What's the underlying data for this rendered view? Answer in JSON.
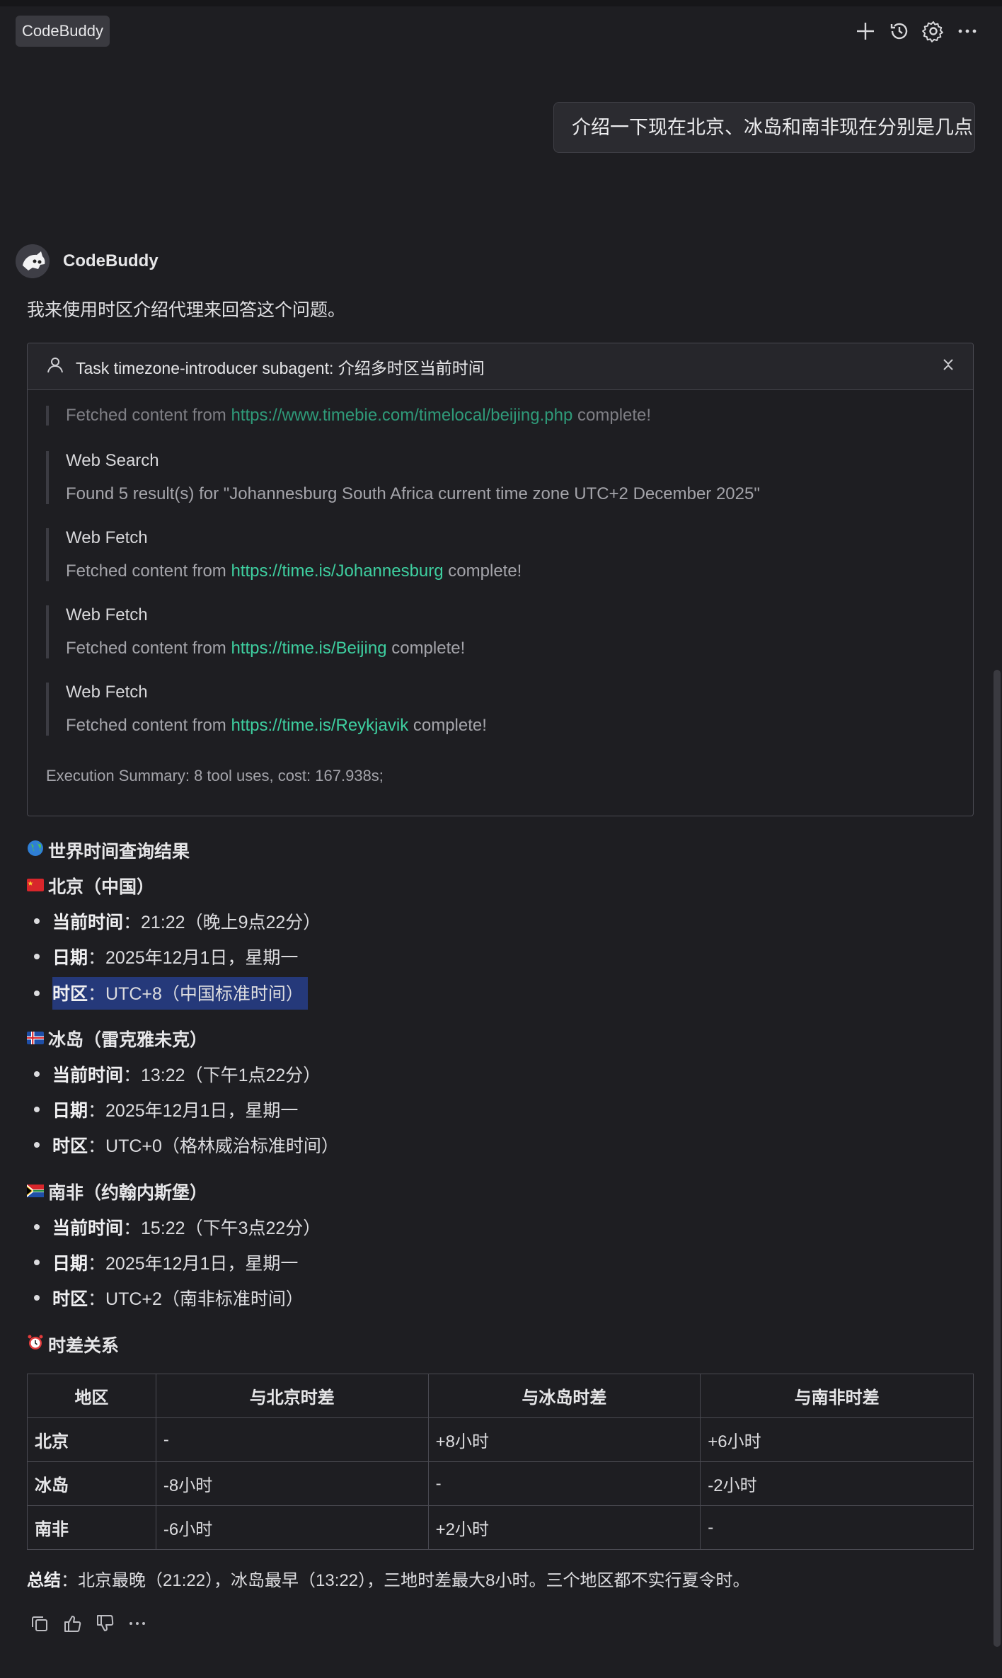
{
  "app": {
    "title": "CodeBuddy"
  },
  "toolbar": {
    "icons": [
      "plus-icon",
      "history-icon",
      "gear-icon",
      "more-icon"
    ]
  },
  "user_message": "介绍一下现在北京、冰岛和南非现在分别是几点",
  "assistant": {
    "name": "CodeBuddy",
    "intro": "我来使用时区介绍代理来回答这个问题。",
    "task": {
      "title": "Task timezone-introducer subagent: 介绍多时区当前时间",
      "steps": [
        {
          "name": "",
          "prefix": "Fetched content from ",
          "url": "https://www.timebie.com/timelocal/beijing.php",
          "suffix": " complete!"
        },
        {
          "name": "Web Search",
          "text": "Found 5 result(s) for \"Johannesburg South Africa current time zone UTC+2 December 2025\""
        },
        {
          "name": "Web Fetch",
          "prefix": "Fetched content from ",
          "url": "https://time.is/Johannesburg",
          "suffix": " complete!"
        },
        {
          "name": "Web Fetch",
          "prefix": "Fetched content from ",
          "url": "https://time.is/Beijing",
          "suffix": " complete!"
        },
        {
          "name": "Web Fetch",
          "prefix": "Fetched content from ",
          "url": "https://time.is/Reykjavik",
          "suffix": " complete!"
        }
      ],
      "summary": "Execution Summary: 8 tool uses, cost: 167.938s;"
    },
    "heading": "世界时间查询结果",
    "cities": [
      {
        "title": "北京（中国）",
        "flag": "china-flag",
        "items": [
          {
            "label": "当前时间",
            "value": "：21:22（晚上9点22分）"
          },
          {
            "label": "日期",
            "value": "：2025年12月1日，星期一"
          },
          {
            "label": "时区",
            "value": "：UTC+8（中国标准时间）"
          }
        ]
      },
      {
        "title": "冰岛（雷克雅未克）",
        "flag": "iceland-flag",
        "items": [
          {
            "label": "当前时间",
            "value": "：13:22（下午1点22分）"
          },
          {
            "label": "日期",
            "value": "：2025年12月1日，星期一"
          },
          {
            "label": "时区",
            "value": "：UTC+0（格林威治标准时间）"
          }
        ]
      },
      {
        "title": "南非（约翰内斯堡）",
        "flag": "south-africa-flag",
        "items": [
          {
            "label": "当前时间",
            "value": "：15:22（下午3点22分）"
          },
          {
            "label": "日期",
            "value": "：2025年12月1日，星期一"
          },
          {
            "label": "时区",
            "value": "：UTC+2（南非标准时间）"
          }
        ]
      }
    ],
    "diff_heading": "时差关系",
    "table": {
      "headers": [
        "地区",
        "与北京时差",
        "与冰岛时差",
        "与南非时差"
      ],
      "rows": [
        [
          "北京",
          "-",
          "+8小时",
          "+6小时"
        ],
        [
          "冰岛",
          "-8小时",
          "-",
          "-2小时"
        ],
        [
          "南非",
          "-6小时",
          "+2小时",
          "-"
        ]
      ]
    },
    "conclusion": {
      "label": "总结",
      "text": "：北京最晚（21:22），冰岛最早（13:22），三地时差最大8小时。三个地区都不实行夏令时。"
    }
  },
  "colors": {
    "background": "#1e1e22",
    "link": "#3ecfa0",
    "selection": "#25397a"
  }
}
